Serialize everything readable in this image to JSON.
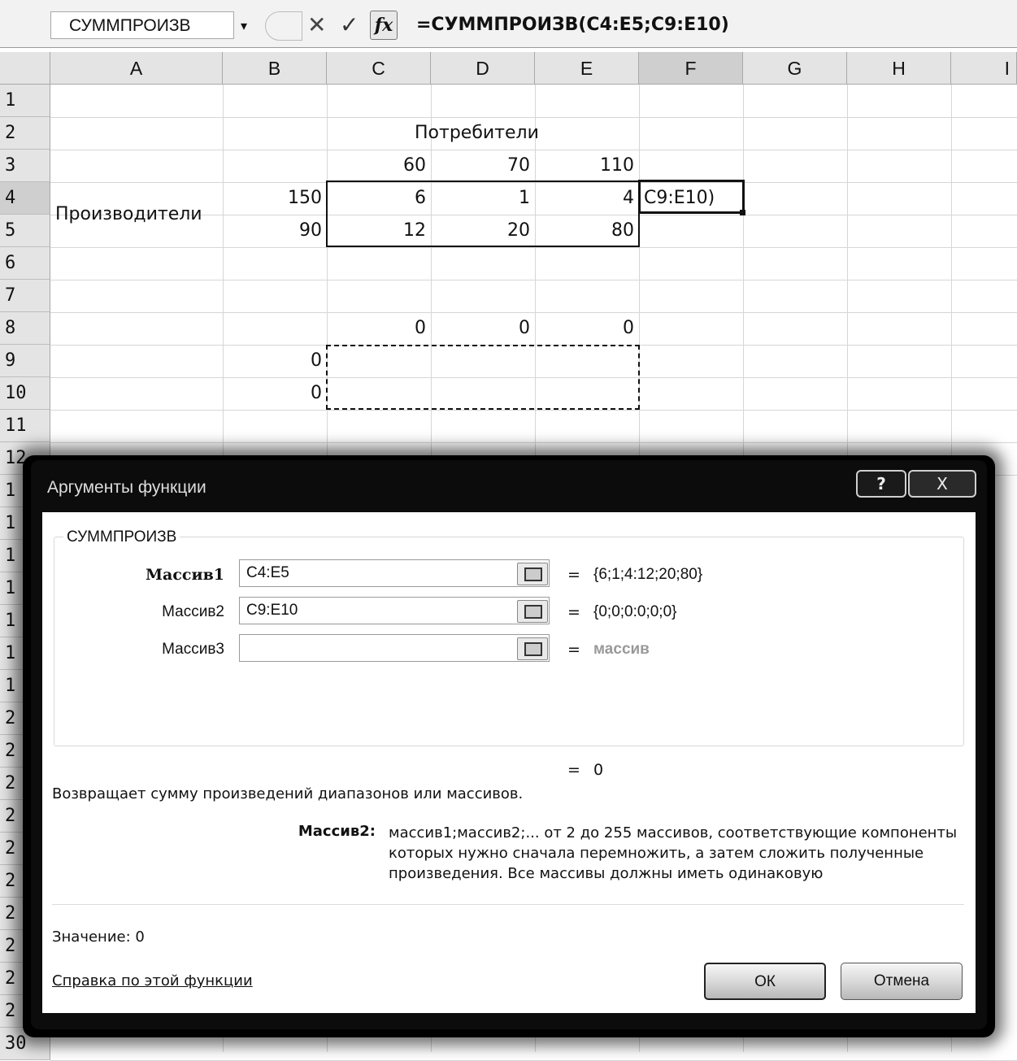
{
  "formula_bar": {
    "name_box": "СУММПРОИЗВ",
    "formula": "=СУММПРОИЗВ(C4:E5;C9:E10)",
    "fx": "fx",
    "cancel": "✕",
    "enter": "✓",
    "drop": "▾"
  },
  "columns": [
    "A",
    "B",
    "C",
    "D",
    "E",
    "F",
    "G",
    "H",
    "I"
  ],
  "rows": [
    "1",
    "2",
    "3",
    "4",
    "5",
    "6",
    "7",
    "8",
    "9",
    "10",
    "11",
    "12",
    "1",
    "1",
    "1",
    "1",
    "1",
    "1",
    "1",
    "2",
    "2",
    "2",
    "2",
    "2",
    "2",
    "2",
    "2",
    "2",
    "2",
    "30"
  ],
  "cells": {
    "d2": "Потребители",
    "c3": "60",
    "d3": "70",
    "e3": "110",
    "a45": "Производители",
    "b4": "150",
    "c4": "6",
    "d4": "1",
    "e4": "4",
    "f4": "C9:E10)",
    "b5": "90",
    "c5": "12",
    "d5": "20",
    "e5": "80",
    "c8": "0",
    "d8": "0",
    "e8": "0",
    "b9": "0",
    "b10": "0"
  },
  "dialog": {
    "title": "Аргументы функции",
    "help_button": "?",
    "close_button": "X",
    "function_name": "СУММПРОИЗВ",
    "args": [
      {
        "label": "Массив1",
        "value": "C4:E5",
        "result": "{6;1;4:12;20;80}"
      },
      {
        "label": "Массив2",
        "value": "C9:E10",
        "result": "{0;0;0:0;0;0}"
      },
      {
        "label": "Массив3",
        "value": "",
        "result": "массив"
      }
    ],
    "equals": "=",
    "formula_result": "0",
    "description": "Возвращает сумму произведений диапазонов или массивов.",
    "arg_help_name": "Массив2:",
    "arg_help_text": "массив1;массив2;... от 2 до 255 массивов, соответствующие компоненты которых нужно сначала перемножить, а затем сложить полученные произведения. Все массивы должны иметь одинаковую",
    "value_line": "Значение:  0",
    "help_link": "Справка по этой функции",
    "ok": "ОК",
    "cancel": "Отмена"
  }
}
